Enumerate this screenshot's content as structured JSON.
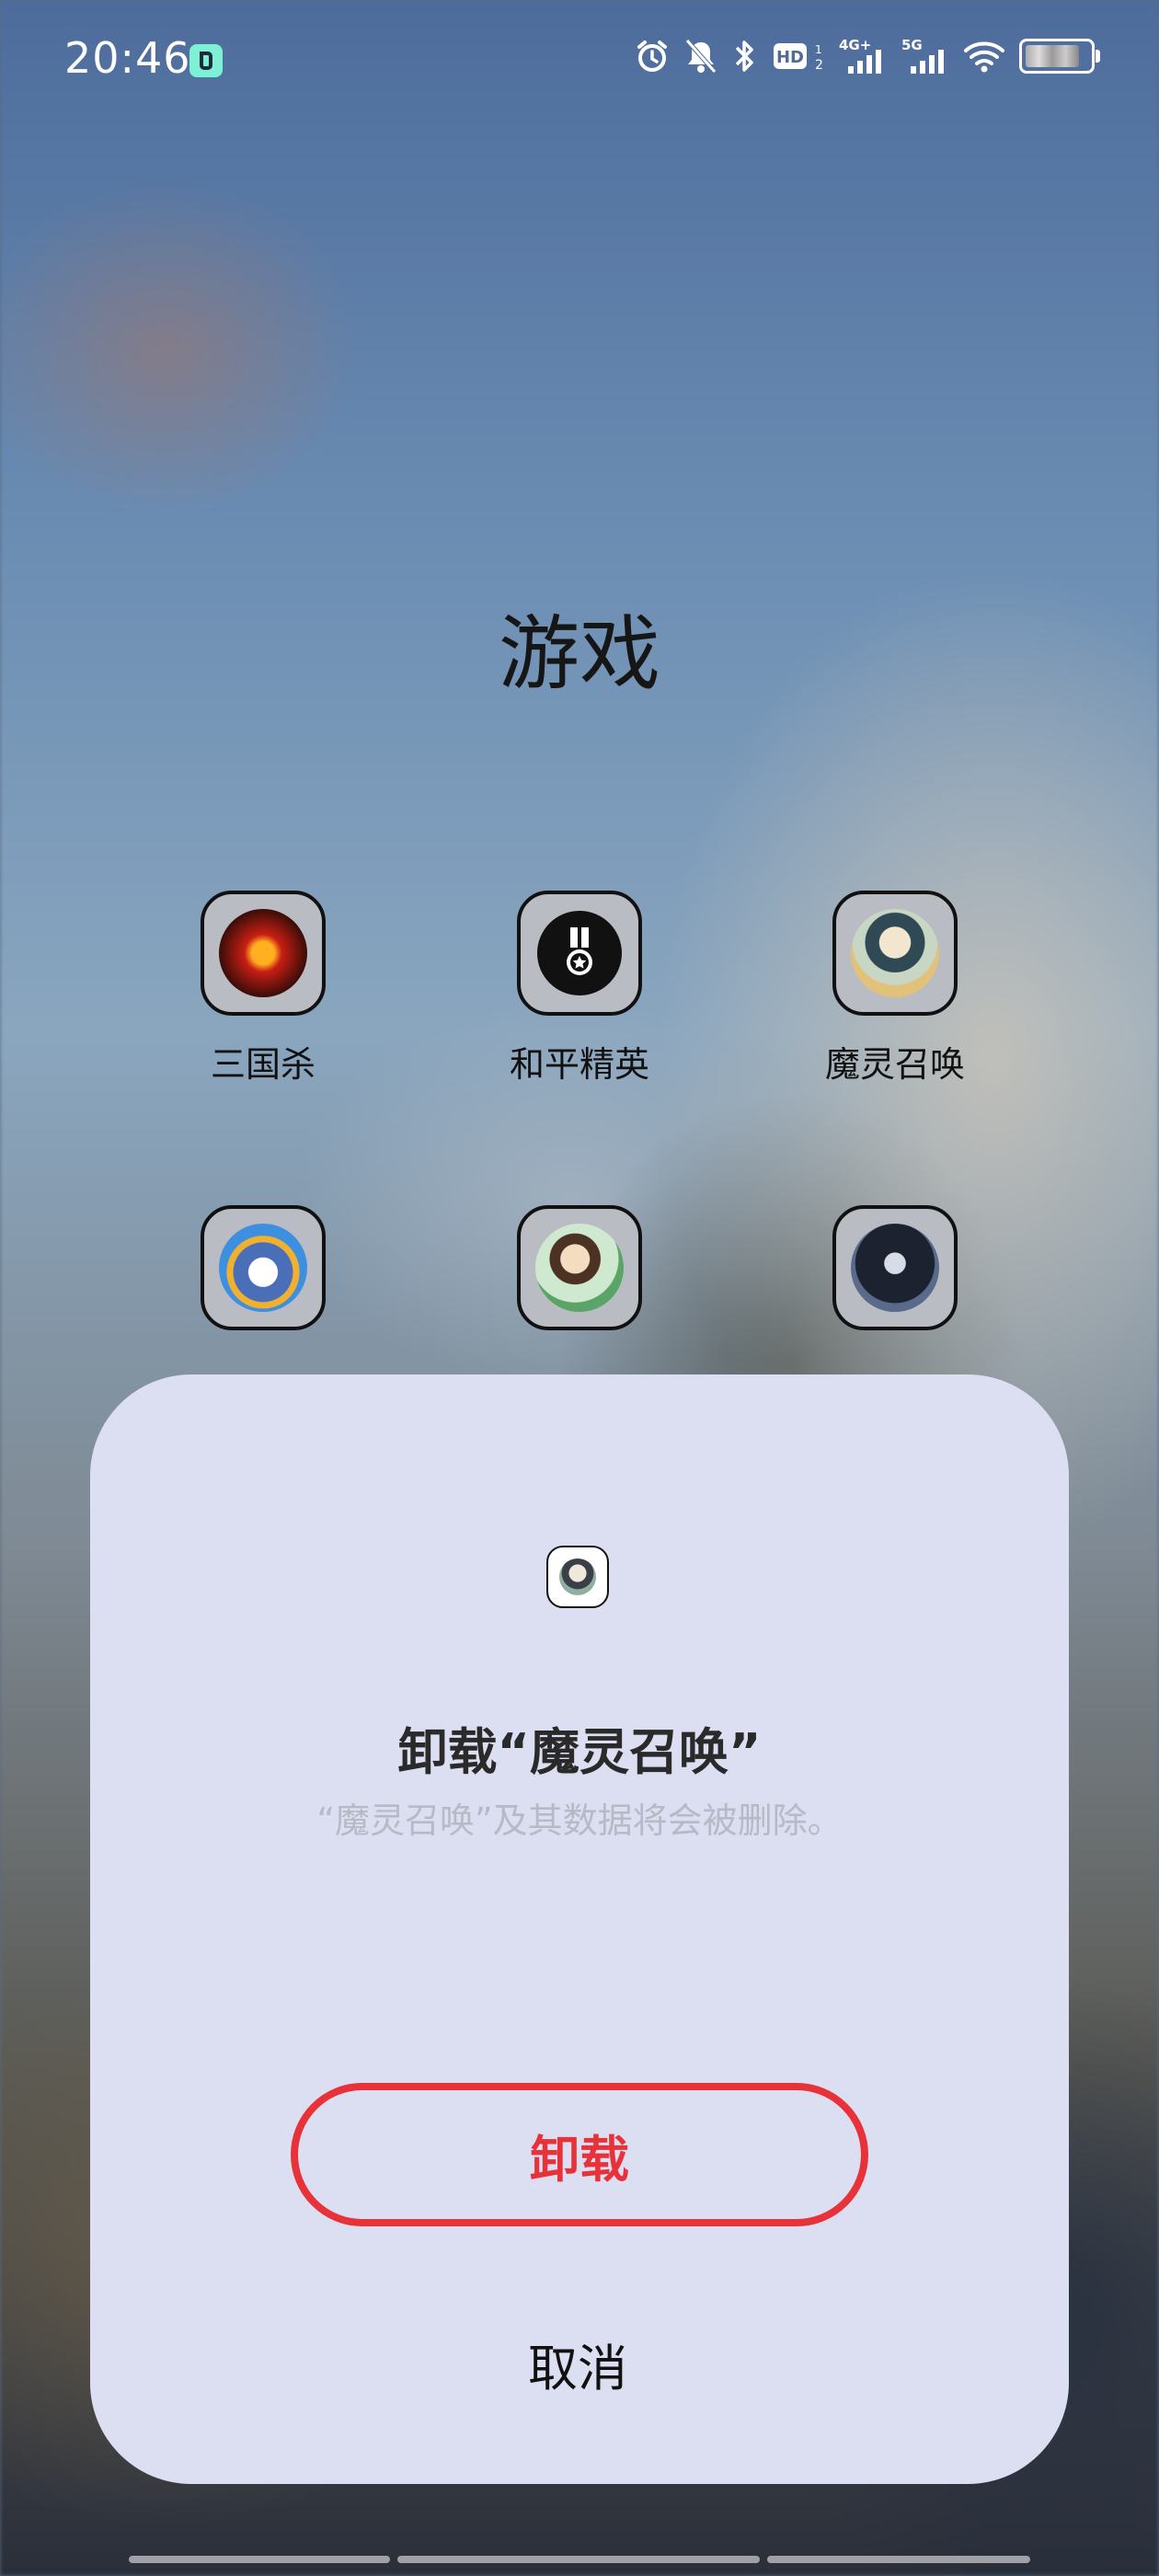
{
  "status_bar": {
    "time": "20:46",
    "icons": [
      "app-notification-icon",
      "alarm-icon",
      "mute-bell-icon",
      "bluetooth-icon",
      "hd-voice-icon",
      "signal-4g-icon",
      "signal-5g-icon",
      "wifi-icon",
      "battery-icon"
    ],
    "hd_label": "HD",
    "sim_4g": "4G+",
    "sim_5g": "5G"
  },
  "folder": {
    "title": "游戏",
    "apps": [
      {
        "label": "三国杀",
        "icon": "sanguosha-icon"
      },
      {
        "label": "和平精英",
        "icon": "peace-elite-icon"
      },
      {
        "label": "魔灵召唤",
        "icon": "summoners-war-icon"
      },
      {
        "label": "",
        "icon": "penguin-game-icon"
      },
      {
        "label": "",
        "icon": "anime-game-icon"
      },
      {
        "label": "",
        "icon": "dark-hero-game-icon"
      }
    ]
  },
  "dialog": {
    "icon": "summoners-war-icon",
    "title": "卸载“魔灵召唤”",
    "description": "“魔灵召唤”及其数据将会被删除。",
    "uninstall_label": "卸载",
    "cancel_label": "取消"
  },
  "colors": {
    "danger": "#e8323a",
    "dialog_bg": "#dcdff1"
  }
}
